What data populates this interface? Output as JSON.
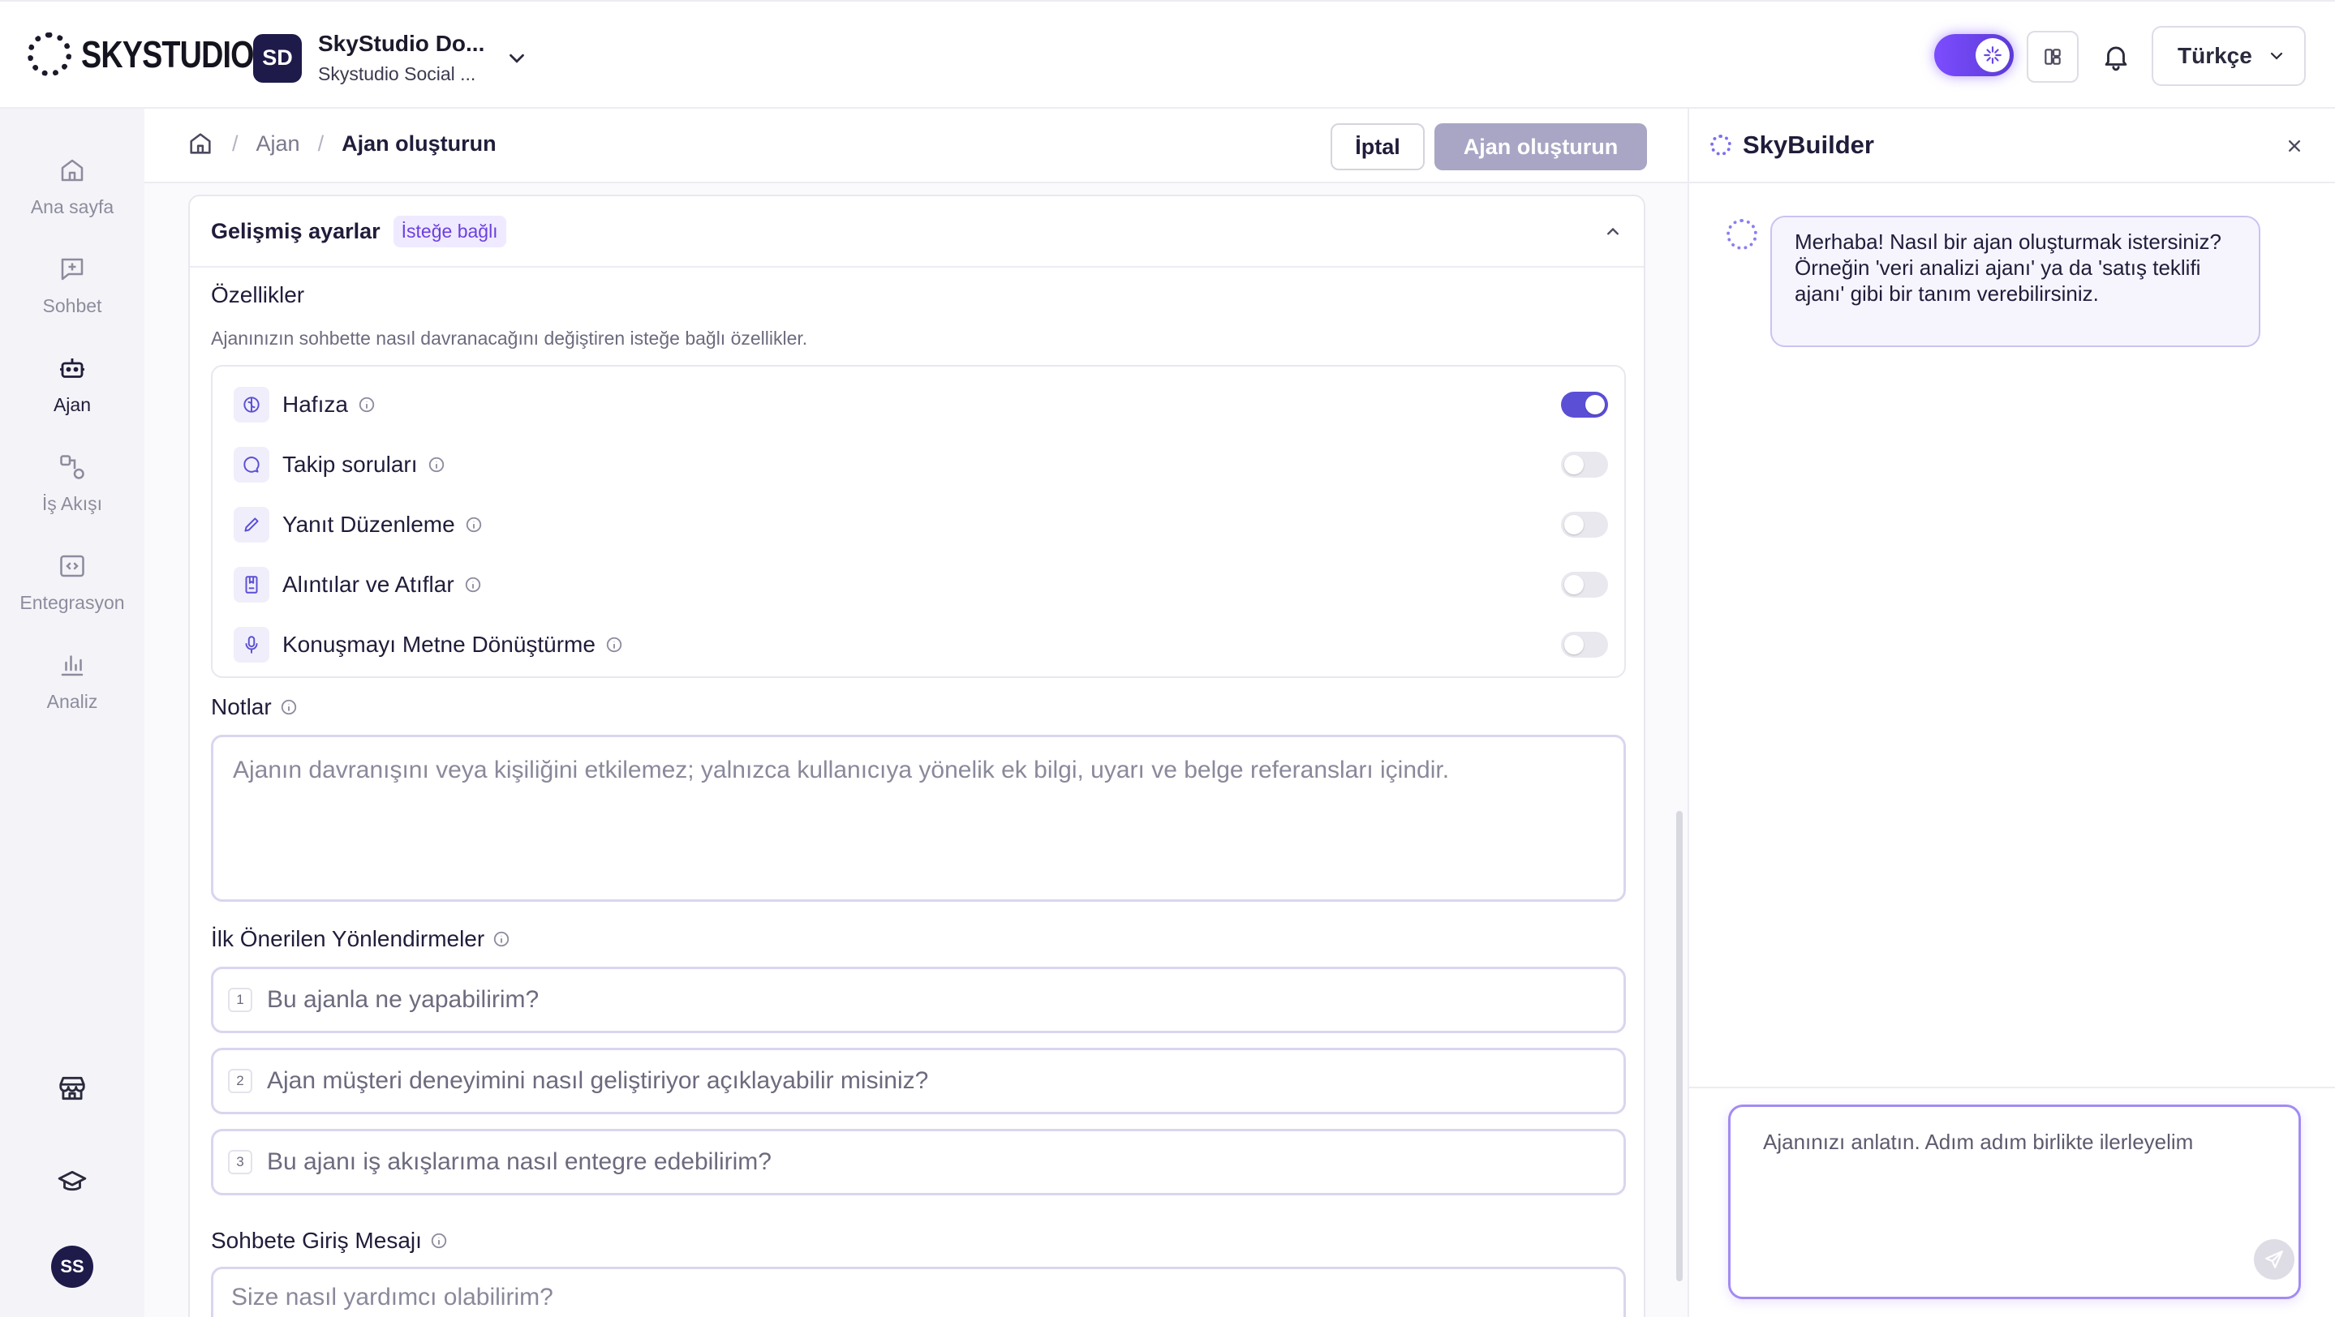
{
  "header": {
    "logo_text": "SKYSTUDIO",
    "workspace": {
      "initials": "SD",
      "name": "SkyStudio Do...",
      "sub": "Skystudio Social ..."
    },
    "language": "Türkçe"
  },
  "sidebar": {
    "items": [
      {
        "label": "Ana sayfa",
        "icon": "home-icon"
      },
      {
        "label": "Sohbet",
        "icon": "chat-plus-icon"
      },
      {
        "label": "Ajan",
        "icon": "robot-icon",
        "active": true
      },
      {
        "label": "İş Akışı",
        "icon": "workflow-icon"
      },
      {
        "label": "Entegrasyon",
        "icon": "code-icon"
      },
      {
        "label": "Analiz",
        "icon": "bar-chart-icon"
      }
    ],
    "user_initials": "SS"
  },
  "breadcrumb": {
    "parent": "Ajan",
    "current": "Ajan oluşturun"
  },
  "actions": {
    "cancel": "İptal",
    "create": "Ajan oluşturun"
  },
  "advanced": {
    "title": "Gelişmiş ayarlar",
    "badge": "İsteğe bağlı",
    "features_title": "Özellikler",
    "features_desc": "Ajanınızın sohbette nasıl davranacağını değiştiren isteğe bağlı özellikler.",
    "features": [
      {
        "label": "Hafıza",
        "icon": "brain-icon",
        "enabled": true
      },
      {
        "label": "Takip soruları",
        "icon": "message-circle-icon",
        "enabled": false
      },
      {
        "label": "Yanıt Düzenleme",
        "icon": "pencil-icon",
        "enabled": false
      },
      {
        "label": "Alıntılar ve Atıflar",
        "icon": "bookmark-file-icon",
        "enabled": false
      },
      {
        "label": "Konuşmayı Metne Dönüştürme",
        "icon": "microphone-icon",
        "enabled": false
      }
    ],
    "notes_title": "Notlar",
    "notes_placeholder": "Ajanın davranışını veya kişiliğini etkilemez; yalnızca kullanıcıya yönelik ek bilgi, uyarı ve belge referansları içindir.",
    "prompts_title": "İlk Önerilen Yönlendirmeler",
    "prompts": [
      {
        "num": "1",
        "text": "Bu ajanla ne yapabilirim?"
      },
      {
        "num": "2",
        "text": "Ajan müşteri deneyimini nasıl geliştiriyor açıklayabilir misiniz?"
      },
      {
        "num": "3",
        "text": "Bu ajanı iş akışlarıma nasıl entegre edebilirim?"
      }
    ],
    "welcome_title": "Sohbete Giriş Mesajı",
    "welcome_placeholder": "Size nasıl yardımcı olabilirim?"
  },
  "skybuilder": {
    "title": "SkyBuilder",
    "message": "Merhaba! Nasıl bir ajan oluşturmak istersiniz? Örneğin 'veri analizi ajanı' ya da 'satış teklifi ajanı' gibi bir tanım verebilirsiniz.",
    "input_placeholder": "Ajanınızı anlatın. Adım adım birlikte ilerleyelim"
  },
  "colors": {
    "accent": "#5b4fd6",
    "brand_dark": "#1e1b4b",
    "disabled_button": "#a8a6c4"
  }
}
